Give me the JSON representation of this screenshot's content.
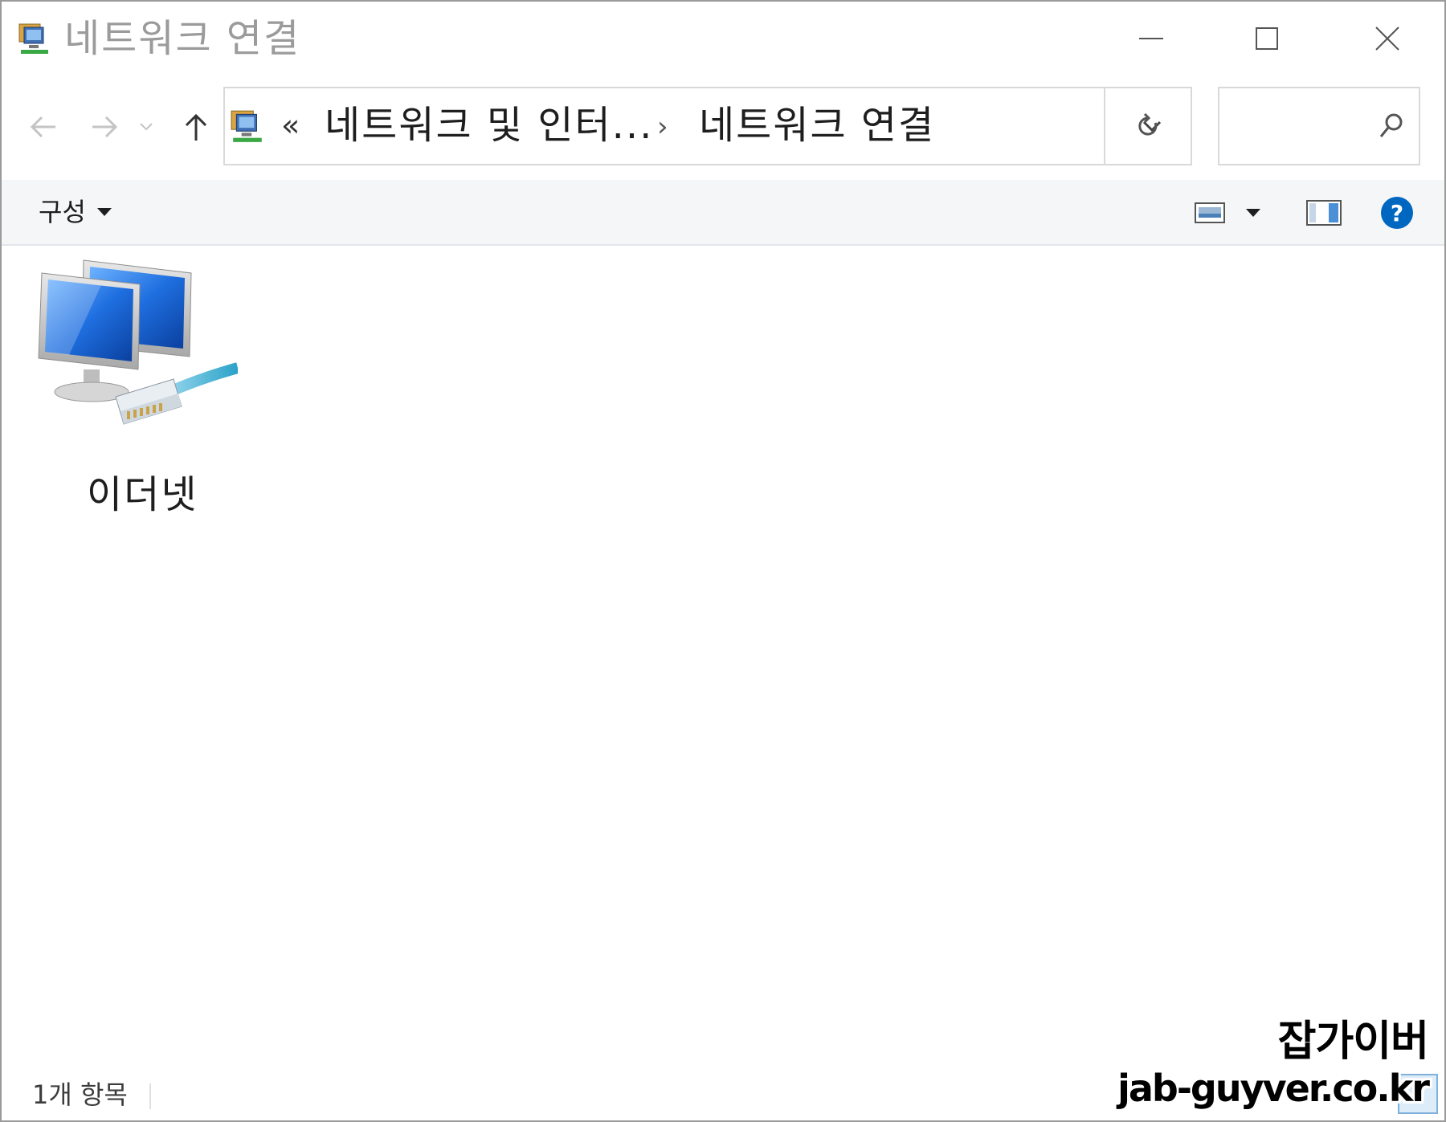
{
  "window": {
    "title": "네트워크 연결",
    "icon": "network-connections-icon"
  },
  "titlebar_buttons": {
    "minimize": "minimize-icon",
    "maximize": "maximize-icon",
    "close": "close-icon"
  },
  "navigation": {
    "back": "back-arrow-icon",
    "forward": "forward-arrow-icon",
    "recent": "chevron-down-icon",
    "up": "up-arrow-icon"
  },
  "address": {
    "overflow": "«",
    "crumbs": [
      "네트워크 및 인터...",
      "네트워크 연결"
    ],
    "separator": "›"
  },
  "search": {
    "placeholder": ""
  },
  "commandbar": {
    "organize_label": "구성"
  },
  "items": [
    {
      "label": "이더넷",
      "icon": "ethernet-adapter-icon"
    }
  ],
  "status": {
    "count_text": "1개 항목"
  },
  "watermark": {
    "line1": "잡가이버",
    "line2": "jab-guyver.co.kr"
  },
  "colors": {
    "accent_blue": "#1e6fd0",
    "help_blue": "#0067c0",
    "title_gray": "#9b9b9b",
    "commandbar_bg": "#f5f6f7"
  }
}
